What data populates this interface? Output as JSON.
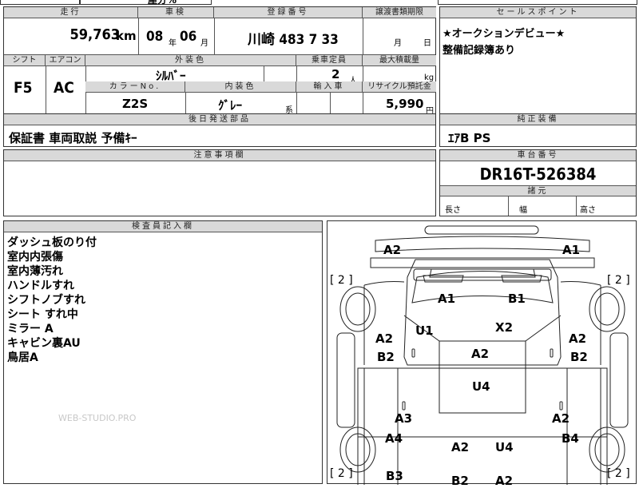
{
  "top_strip": {
    "partial_text": "屋分%"
  },
  "vehicle": {
    "headers": {
      "mileage": "走行",
      "inspection": "車検",
      "registration": "登録番号",
      "transfer_deadline": "譲渡書類期限",
      "shift": "シフト",
      "aircon": "エアコン",
      "exterior_color": "外装色",
      "capacity": "乗車定員",
      "max_load": "最大積載量",
      "color_no": "カラーNo.",
      "interior_color": "内装色",
      "import": "輸入車",
      "recycle": "リサイクル預託金",
      "followup": "後日発送部品",
      "notes": "注意事項欄",
      "sales_points": "セールスポイント",
      "equipment": "純正装備",
      "chassis_no": "車台番号",
      "dimensions": "諸元",
      "inspector": "検査員記入欄"
    },
    "mileage": "59,763",
    "mileage_unit": "km",
    "inspection_year": "08",
    "inspection_year_unit": "年",
    "inspection_month": "06",
    "inspection_month_unit": "月",
    "registration": "川崎 483 7 33",
    "transfer_month_unit": "月",
    "transfer_day_unit": "日",
    "shift": "F5",
    "aircon": "AC",
    "exterior_color": "ｼﾙﾊﾞｰ",
    "capacity": "2",
    "capacity_unit": "人",
    "max_load_unit": "kg",
    "color_no": "Z2S",
    "interior_color": "ｸﾞﾚｰ",
    "interior_color_suffix": "系",
    "recycle_fee": "5,990",
    "recycle_unit": "円",
    "followup_parts": "保証書 車両取説 予備ｷｰ",
    "sales_points": [
      "★オークションデビュー★",
      "整備記録簿あり"
    ],
    "equipment": "ｴｱB PS",
    "chassis_no": "DR16T-526384",
    "dim_length": "長さ",
    "dim_width": "幅",
    "dim_height": "高さ"
  },
  "inspector_notes": [
    "ダッシュ板のり付",
    "室内内張傷",
    "室内薄汚れ",
    "ハンドルすれ",
    "シフトノブすれ",
    "シート すれ中",
    "ミラー A",
    "キャビン裏AU",
    "鳥居A"
  ],
  "watermark": "WEB-STUDIO.PRO",
  "diagram": {
    "brackets": [
      "[ 2 ]",
      "[ 2 ]",
      "[ 2 ]",
      "[ 2 ]"
    ],
    "marks": [
      "A2",
      "A1",
      "A1",
      "B1",
      "U1",
      "X2",
      "A2",
      "B2",
      "A2",
      "A2",
      "B2",
      "U4",
      "A3",
      "A2",
      "A4",
      "B4",
      "A2",
      "U4",
      "B3",
      "B2",
      "A2"
    ]
  }
}
